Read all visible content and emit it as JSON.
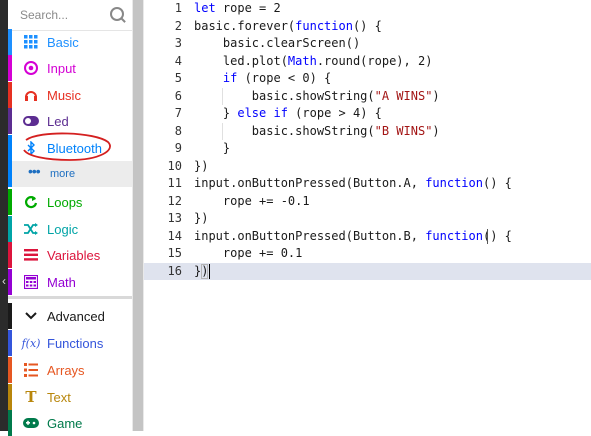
{
  "toolbox": {
    "search_placeholder": "Search...",
    "categories": [
      {
        "label": "Basic",
        "color": "#1e90ff",
        "icon": "grid-icon"
      },
      {
        "label": "Input",
        "color": "#d400d4",
        "icon": "target-icon"
      },
      {
        "label": "Music",
        "color": "#e63022",
        "icon": "headphones-icon"
      },
      {
        "label": "Led",
        "color": "#5c2d91",
        "icon": "toggle-icon"
      },
      {
        "label": "Bluetooth",
        "color": "#0082fb",
        "icon": "bluetooth-icon"
      },
      {
        "label": "more",
        "color": "#0082fb",
        "icon": "more-dots-icon"
      },
      {
        "label": "Loops",
        "color": "#00aa00",
        "icon": "loop-icon"
      },
      {
        "label": "Logic",
        "color": "#00a4a6",
        "icon": "shuffle-icon"
      },
      {
        "label": "Variables",
        "color": "#dc143c",
        "icon": "list-icon"
      },
      {
        "label": "Math",
        "color": "#9400d3",
        "icon": "calculator-icon"
      },
      {
        "label": "Advanced",
        "color": "#1a1a1a",
        "icon": "chevron-down-icon"
      },
      {
        "label": "Functions",
        "color": "#3455db",
        "icon": "function-icon"
      },
      {
        "label": "Arrays",
        "color": "#e65722",
        "icon": "arrays-icon"
      },
      {
        "label": "Text",
        "color": "#b8860b",
        "icon": "text-icon"
      },
      {
        "label": "Game",
        "color": "#007a4b",
        "icon": "gamepad-icon"
      }
    ]
  },
  "editor": {
    "lines": [
      {
        "n": "1",
        "text": "let rope = 2"
      },
      {
        "n": "2",
        "text": "basic.forever(function() {"
      },
      {
        "n": "3",
        "text": "    basic.clearScreen()"
      },
      {
        "n": "4",
        "text": "    led.plot(Math.round(rope), 2)"
      },
      {
        "n": "5",
        "text": "    if (rope < 0) {"
      },
      {
        "n": "6",
        "text": "        basic.showString(\"A WINS\")"
      },
      {
        "n": "7",
        "text": "    } else if (rope > 4) {"
      },
      {
        "n": "8",
        "text": "        basic.showString(\"B WINS\")"
      },
      {
        "n": "9",
        "text": "    }"
      },
      {
        "n": "10",
        "text": "})"
      },
      {
        "n": "11",
        "text": "input.onButtonPressed(Button.A, function() {"
      },
      {
        "n": "12",
        "text": "    rope += -0.1"
      },
      {
        "n": "13",
        "text": "})"
      },
      {
        "n": "14",
        "text": "input.onButtonPressed(Button.B, function() {"
      },
      {
        "n": "15",
        "text": "    rope += 0.1"
      },
      {
        "n": "16",
        "text": "})"
      }
    ],
    "current_line": 16
  }
}
